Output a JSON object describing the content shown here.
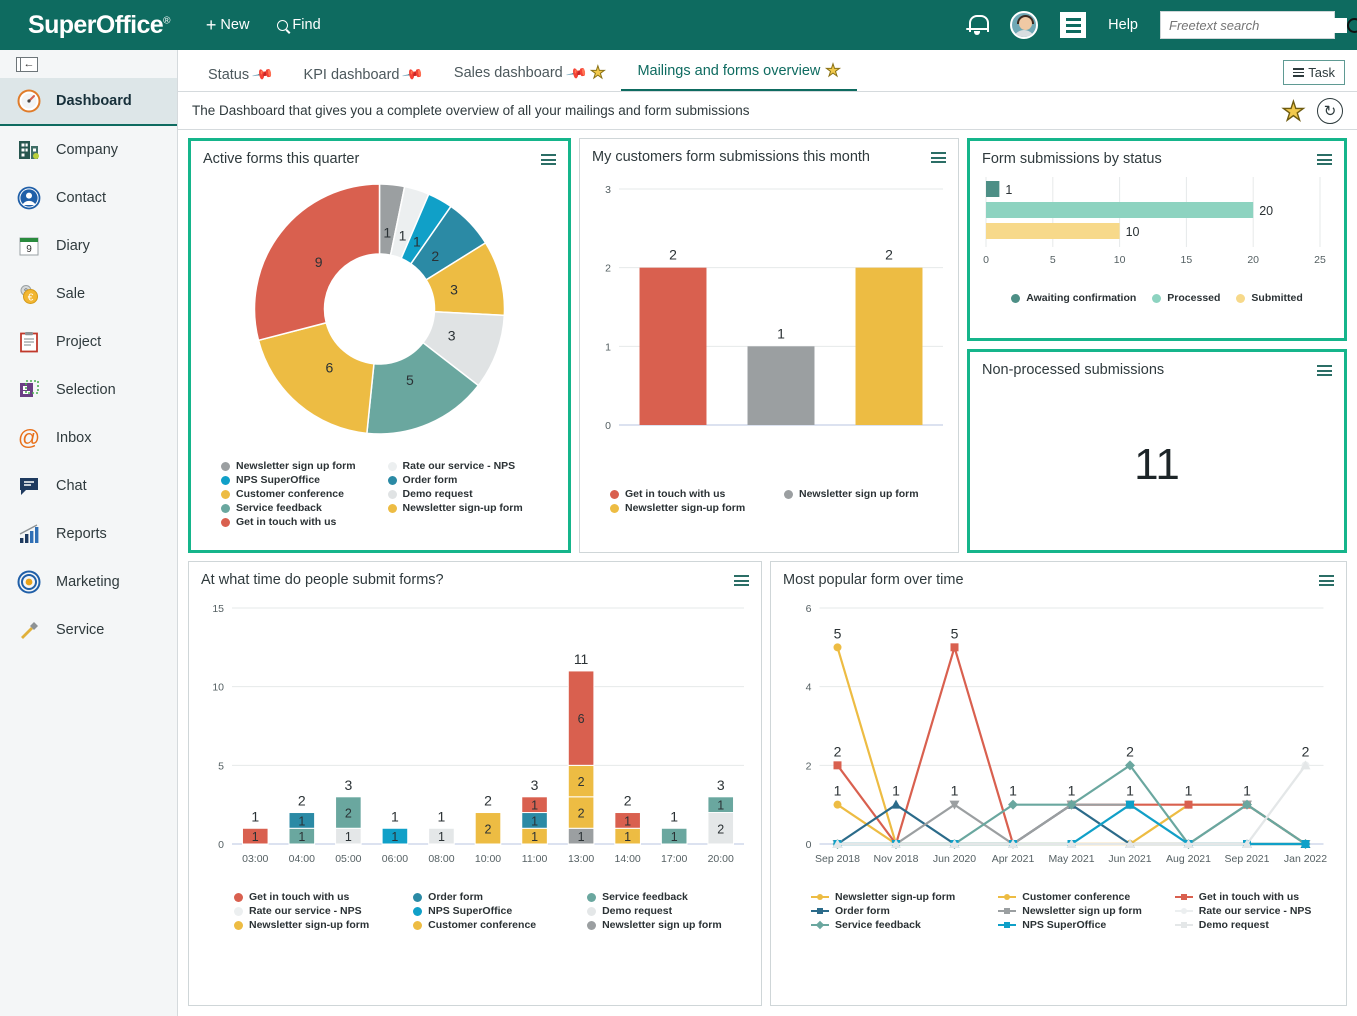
{
  "topbar": {
    "logo": "SuperOffice",
    "logo_reg": "®",
    "new_label": "New",
    "find_label": "Find",
    "help_label": "Help",
    "search_placeholder": "Freetext search",
    "icons": [
      "bell-icon",
      "avatar",
      "hamburger-icon",
      "search-icon"
    ]
  },
  "sidebar": {
    "collapse_label": "←",
    "items": [
      {
        "label": "Dashboard",
        "icon": "gauge-icon",
        "active": true
      },
      {
        "label": "Company",
        "icon": "building-icon",
        "active": false
      },
      {
        "label": "Contact",
        "icon": "person-icon",
        "active": false
      },
      {
        "label": "Diary",
        "icon": "calendar-icon",
        "active": false
      },
      {
        "label": "Sale",
        "icon": "coin-icon",
        "active": false
      },
      {
        "label": "Project",
        "icon": "clipboard-icon",
        "active": false
      },
      {
        "label": "Selection",
        "icon": "selection-icon",
        "active": false
      },
      {
        "label": "Inbox",
        "icon": "at-icon",
        "active": false
      },
      {
        "label": "Chat",
        "icon": "chat-bubble-icon",
        "active": false
      },
      {
        "label": "Reports",
        "icon": "bar-chart-icon",
        "active": false
      },
      {
        "label": "Marketing",
        "icon": "target-icon",
        "active": false
      },
      {
        "label": "Service",
        "icon": "wrench-icon",
        "active": false
      }
    ]
  },
  "tabs": [
    {
      "label": "Status",
      "pinned": true,
      "starred": false,
      "active": false
    },
    {
      "label": "KPI dashboard",
      "pinned": true,
      "starred": false,
      "active": false
    },
    {
      "label": "Sales dashboard",
      "pinned": true,
      "starred": true,
      "active": false
    },
    {
      "label": "Mailings and forms overview",
      "pinned": false,
      "starred": true,
      "active": true
    }
  ],
  "task_button": "Task",
  "description": "The Dashboard that gives you a complete overview of all your mailings and form submissions",
  "colors": {
    "brand_green": "#0e6b60",
    "selected_border": "#15b58b",
    "red": "#d9604f",
    "yellow": "#edbc43",
    "sea_green": "#6aa79f",
    "teal_blue": "#2b8aa5",
    "cyan": "#10a0c8",
    "gray": "#9b9fa1",
    "light_gray": "#e4e7e8",
    "mint": "#8dd3c0",
    "pale_yellow": "#f7d98a",
    "dark_teal": "#4d8f86"
  },
  "chart_data": [
    {
      "type": "pie",
      "id": "active-forms-this-quarter",
      "title": "Active forms this quarter",
      "selected": true,
      "labels": [
        "Newsletter sign up form",
        "Rate our service - NPS",
        "NPS SuperOffice",
        "Order form",
        "Customer conference",
        "Demo request",
        "Service feedback",
        "Newsletter sign-up form",
        "Get in touch with us"
      ],
      "values": [
        1,
        1,
        1,
        2,
        3,
        3,
        5,
        6,
        9
      ],
      "slice_colors": [
        "#9b9fa1",
        "#eceff0",
        "#10a0c8",
        "#2b8aa5",
        "#edbc43",
        "#e0e3e4",
        "#6aa79f",
        "#edbc43",
        "#d9604f"
      ],
      "legend": [
        {
          "label": "Newsletter sign up form",
          "color": "#9b9fa1"
        },
        {
          "label": "Rate our service - NPS",
          "color": "#eceff0"
        },
        {
          "label": "NPS SuperOffice",
          "color": "#10a0c8"
        },
        {
          "label": "Order form",
          "color": "#2b8aa5"
        },
        {
          "label": "Customer conference",
          "color": "#edbc43"
        },
        {
          "label": "Demo request",
          "color": "#e0e3e4"
        },
        {
          "label": "Service feedback",
          "color": "#6aa79f"
        },
        {
          "label": "Newsletter sign-up form",
          "color": "#edbc43"
        },
        {
          "label": "Get in touch with us",
          "color": "#d9604f"
        }
      ],
      "legend_position": "bottom",
      "total": 31
    },
    {
      "type": "bar",
      "id": "my-customers-form-submissions-this-month",
      "title": "My customers form submissions this month",
      "categories": [
        "Get in touch with us",
        "Newsletter sign up form",
        "Newsletter sign-up form"
      ],
      "values": [
        2,
        1,
        2
      ],
      "bar_colors": [
        "#d9604f",
        "#9b9fa1",
        "#edbc43"
      ],
      "ylim": [
        0,
        3
      ],
      "yticks": [
        0,
        1,
        2,
        3
      ],
      "legend": [
        {
          "label": "Get in touch with us",
          "color": "#d9604f"
        },
        {
          "label": "Newsletter sign up form",
          "color": "#9b9fa1"
        },
        {
          "label": "Newsletter sign-up form",
          "color": "#edbc43"
        }
      ],
      "legend_position": "bottom"
    },
    {
      "type": "bar",
      "id": "form-submissions-by-status",
      "title": "Form submissions by status",
      "selected": true,
      "orientation": "horizontal",
      "categories": [
        "Awaiting confirmation",
        "Processed",
        "Submitted"
      ],
      "values": [
        1,
        20,
        10
      ],
      "bar_colors": [
        "#4d8f86",
        "#8dd3c0",
        "#f7d98a"
      ],
      "xlim": [
        0,
        25
      ],
      "xticks": [
        0,
        5,
        10,
        15,
        20,
        25
      ],
      "legend": [
        {
          "label": "Awaiting confirmation",
          "color": "#4d8f86"
        },
        {
          "label": "Processed",
          "color": "#8dd3c0"
        },
        {
          "label": "Submitted",
          "color": "#f7d98a"
        }
      ],
      "legend_position": "bottom"
    },
    {
      "type": "table",
      "id": "non-processed-submissions",
      "title": "Non-processed submissions",
      "selected": true,
      "value": "11"
    },
    {
      "type": "bar",
      "id": "at-what-time-do-people-submit-forms",
      "title": "At what time do people submit forms?",
      "stacked": true,
      "categories": [
        "03:00",
        "04:00",
        "05:00",
        "06:00",
        "08:00",
        "10:00",
        "11:00",
        "13:00",
        "14:00",
        "17:00",
        "20:00"
      ],
      "totals": [
        1,
        2,
        3,
        1,
        1,
        2,
        3,
        11,
        2,
        1,
        3
      ],
      "ylim": [
        0,
        15
      ],
      "yticks": [
        0,
        5,
        10,
        15
      ],
      "stacks": [
        [
          {
            "v": 1,
            "c": "#d9604f"
          }
        ],
        [
          {
            "v": 1,
            "c": "#6aa79f"
          },
          {
            "v": 1,
            "c": "#2b8aa5"
          }
        ],
        [
          {
            "v": 1,
            "c": "#e4e7e8"
          },
          {
            "v": 2,
            "c": "#6aa79f"
          }
        ],
        [
          {
            "v": 1,
            "c": "#10a0c8"
          }
        ],
        [
          {
            "v": 1,
            "c": "#e4e7e8"
          }
        ],
        [
          {
            "v": 2,
            "c": "#edbc43"
          }
        ],
        [
          {
            "v": 1,
            "c": "#edbc43"
          },
          {
            "v": 1,
            "c": "#2b8aa5"
          },
          {
            "v": 1,
            "c": "#d9604f"
          }
        ],
        [
          {
            "v": 1,
            "c": "#9b9fa1"
          },
          {
            "v": 2,
            "c": "#edbc43"
          },
          {
            "v": 2,
            "c": "#edbc43"
          },
          {
            "v": 6,
            "c": "#d9604f"
          }
        ],
        [
          {
            "v": 1,
            "c": "#edbc43"
          },
          {
            "v": 1,
            "c": "#d9604f"
          }
        ],
        [
          {
            "v": 1,
            "c": "#6aa79f"
          }
        ],
        [
          {
            "v": 2,
            "c": "#e4e7e8"
          },
          {
            "v": 1,
            "c": "#6aa79f"
          }
        ]
      ],
      "legend": [
        {
          "label": "Get in touch with us",
          "color": "#d9604f"
        },
        {
          "label": "Order form",
          "color": "#2b8aa5"
        },
        {
          "label": "Service feedback",
          "color": "#6aa79f"
        },
        {
          "label": "Rate our service - NPS",
          "color": "#eceff0"
        },
        {
          "label": "NPS SuperOffice",
          "color": "#10a0c8"
        },
        {
          "label": "Demo request",
          "color": "#e4e7e8"
        },
        {
          "label": "Newsletter sign-up form",
          "color": "#edbc43"
        },
        {
          "label": "Customer conference",
          "color": "#edbc43"
        },
        {
          "label": "Newsletter sign up form",
          "color": "#9b9fa1"
        }
      ],
      "legend_position": "bottom"
    },
    {
      "type": "line",
      "id": "most-popular-form-over-time",
      "title": "Most popular form over time",
      "x": [
        "Sep 2018",
        "Nov 2018",
        "Jun 2020",
        "Apr 2021",
        "May 2021",
        "Jun 2021",
        "Aug 2021",
        "Sep 2021",
        "Jan 2022"
      ],
      "ylim": [
        0,
        6
      ],
      "yticks": [
        0,
        2,
        4,
        6
      ],
      "series": [
        {
          "name": "Newsletter sign-up form",
          "color": "#edbc43",
          "marker": "circle",
          "values": [
            5,
            0,
            0,
            0,
            0,
            0,
            0,
            0,
            0
          ]
        },
        {
          "name": "Customer conference",
          "color": "#edbc43",
          "marker": "circle",
          "values": [
            1,
            0,
            0,
            0,
            0,
            0,
            1,
            1,
            0
          ]
        },
        {
          "name": "Get in touch with us",
          "color": "#d9604f",
          "marker": "square",
          "values": [
            2,
            0,
            5,
            0,
            1,
            1,
            1,
            1,
            0
          ]
        },
        {
          "name": "Order form",
          "color": "#2b6b8a",
          "marker": "triangle",
          "values": [
            0,
            1,
            0,
            0,
            1,
            0,
            0,
            0,
            0
          ]
        },
        {
          "name": "Newsletter sign up form",
          "color": "#9b9fa1",
          "marker": "tri-down",
          "values": [
            0,
            0,
            1,
            0,
            1,
            1,
            0,
            1,
            0
          ]
        },
        {
          "name": "Rate our service - NPS",
          "color": "#eceff0",
          "marker": "circle",
          "values": [
            0,
            0,
            0,
            0,
            0,
            1,
            0,
            0,
            2
          ]
        },
        {
          "name": "Service feedback",
          "color": "#6aa79f",
          "marker": "diamond",
          "values": [
            0,
            0,
            0,
            1,
            1,
            2,
            0,
            1,
            0
          ]
        },
        {
          "name": "NPS SuperOffice",
          "color": "#10a0c8",
          "marker": "square",
          "values": [
            0,
            0,
            0,
            0,
            0,
            1,
            0,
            0,
            0
          ]
        },
        {
          "name": "Demo request",
          "color": "#e4e7e8",
          "marker": "tri-up",
          "values": [
            0,
            0,
            0,
            0,
            0,
            0,
            0,
            0,
            2
          ]
        }
      ],
      "point_labels": {
        "Sep 2018": [
          "5",
          "2",
          "1"
        ],
        "Nov 2018": [
          "1"
        ],
        "Jun 2020": [
          "5",
          "1"
        ],
        "Apr 2021": [
          "1"
        ],
        "May 2021": [
          "1"
        ],
        "Jun 2021": [
          "2",
          "1"
        ],
        "Aug 2021": [
          "1"
        ],
        "Sep 2021": [
          "1"
        ],
        "Jan 2022": [
          "2"
        ]
      },
      "legend": [
        {
          "label": "Newsletter sign-up form",
          "color": "#edbc43",
          "marker": "circle"
        },
        {
          "label": "Customer conference",
          "color": "#edbc43",
          "marker": "circle"
        },
        {
          "label": "Get in touch with us",
          "color": "#d9604f",
          "marker": "square"
        },
        {
          "label": "Order form",
          "color": "#2b6b8a",
          "marker": "triangle"
        },
        {
          "label": "Newsletter sign up form",
          "color": "#9b9fa1",
          "marker": "tri-down"
        },
        {
          "label": "Rate our service - NPS",
          "color": "#eceff0",
          "marker": "circle"
        },
        {
          "label": "Service feedback",
          "color": "#6aa79f",
          "marker": "diamond"
        },
        {
          "label": "NPS SuperOffice",
          "color": "#10a0c8",
          "marker": "square"
        },
        {
          "label": "Demo request",
          "color": "#e4e7e8",
          "marker": "tri-up"
        }
      ],
      "legend_position": "bottom"
    }
  ]
}
